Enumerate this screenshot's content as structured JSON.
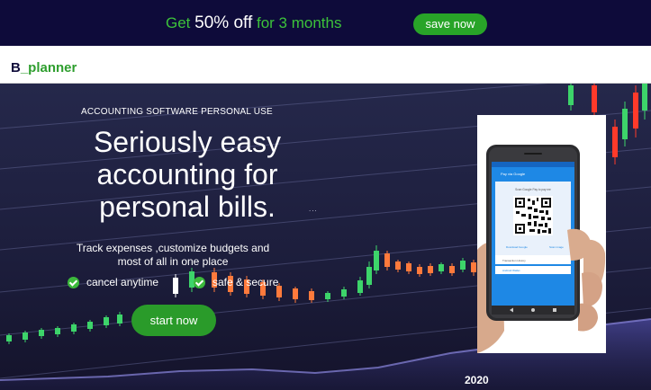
{
  "promo": {
    "get": "Get",
    "offer": "50% off",
    "duration": "for 3 months",
    "save_label": "save now"
  },
  "nav": {
    "logo_b": "B",
    "logo_rest": "_planner"
  },
  "hero": {
    "eyebrow": "ACCOUNTING SOFTWARE PERSONAL USE",
    "headline": "Seriously easy accounting for personal bills.",
    "subline": "Track expenses ,customize budgets and most  of all in one place",
    "features": [
      "cancel anytime",
      "safe & secure"
    ],
    "cta_label": "start now",
    "chart_year": "2020",
    "dots": "..."
  },
  "phone": {
    "screen_title": "Pay via Google",
    "qr_caption": "Scan Google Pay to pay me",
    "link_left": "Download Google",
    "link_right": "Scan image",
    "row_label": "Transaction History",
    "row_label2": "Android Wallet"
  },
  "colors": {
    "promo_bg": "#0e0b3a",
    "accent_green": "#2e9e2e",
    "hero_bg": "#1d1f3f",
    "screen_blue": "#1e88e5"
  }
}
